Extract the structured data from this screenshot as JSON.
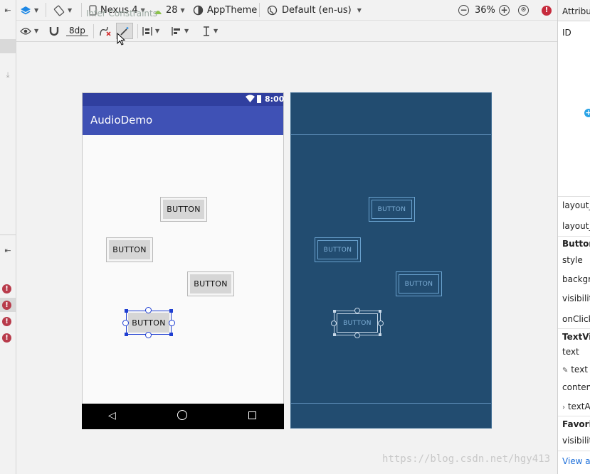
{
  "toolbar1": {
    "device": "Nexus 4",
    "api_level": "28",
    "theme": "AppTheme",
    "locale": "Default (en-us)",
    "zoom": "36%"
  },
  "toolbar2": {
    "margin": "8dp",
    "tooltip": "Infer Constraints"
  },
  "phone": {
    "status_time": "8:00",
    "app_title": "AudioDemo",
    "buttons": [
      "BUTTON",
      "BUTTON",
      "BUTTON",
      "BUTTON"
    ]
  },
  "blueprint": {
    "buttons": [
      "BUTTON",
      "BUTTON",
      "BUTTON",
      "BUTTON"
    ]
  },
  "attributes": {
    "title": "Attribut",
    "rows": [
      "ID",
      "layout_",
      "layout_",
      "Buttor",
      "style",
      "backgr",
      "visibilit",
      "onClick",
      "TextVi",
      "text",
      "text",
      "conten",
      "textA",
      "Favori",
      "visibilit",
      "View a"
    ]
  },
  "watermark": "https://blog.csdn.net/hgy413",
  "colors": {
    "primary": "#3f51b5",
    "primary_dark": "#303f9f",
    "blueprint": "#224c70",
    "selection": "#1f3fd1",
    "error": "#b83b4b"
  }
}
